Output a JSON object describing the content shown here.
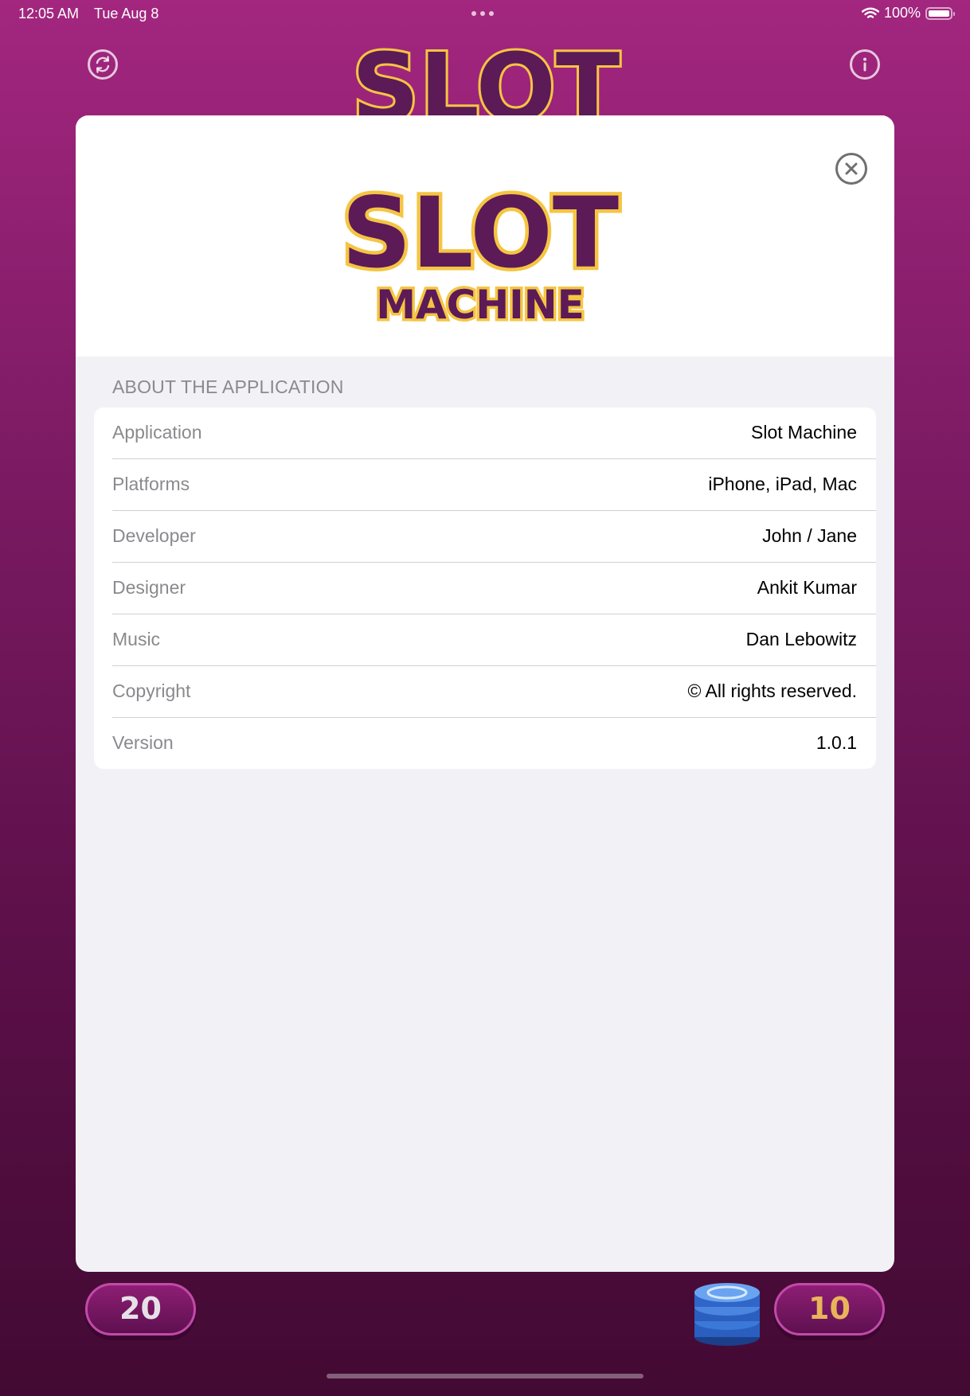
{
  "status_bar": {
    "time": "12:05 AM",
    "date": "Tue Aug 8",
    "battery": "100%"
  },
  "logo": {
    "line1": "SLOT",
    "line2": "MACHINE"
  },
  "section": {
    "title": "ABOUT THE APPLICATION"
  },
  "rows": [
    {
      "label": "Application",
      "value": "Slot Machine"
    },
    {
      "label": "Platforms",
      "value": "iPhone, iPad, Mac"
    },
    {
      "label": "Developer",
      "value": "John / Jane"
    },
    {
      "label": "Designer",
      "value": "Ankit Kumar"
    },
    {
      "label": "Music",
      "value": "Dan Lebowitz"
    },
    {
      "label": "Copyright",
      "value": "© All rights reserved."
    },
    {
      "label": "Version",
      "value": "1.0.1"
    }
  ],
  "game": {
    "coins": "20",
    "bet": "10"
  },
  "icons": {
    "reset": "arrow-2-circlepath-icon",
    "info": "info-circle-icon",
    "close": "xmark-circle-icon",
    "chips": "casino-chips-icon"
  },
  "colors": {
    "background": "#a3267f",
    "logo_fill": "#5c1a57",
    "logo_outline": "#f5c542",
    "bet_text": "#e9b35a"
  }
}
